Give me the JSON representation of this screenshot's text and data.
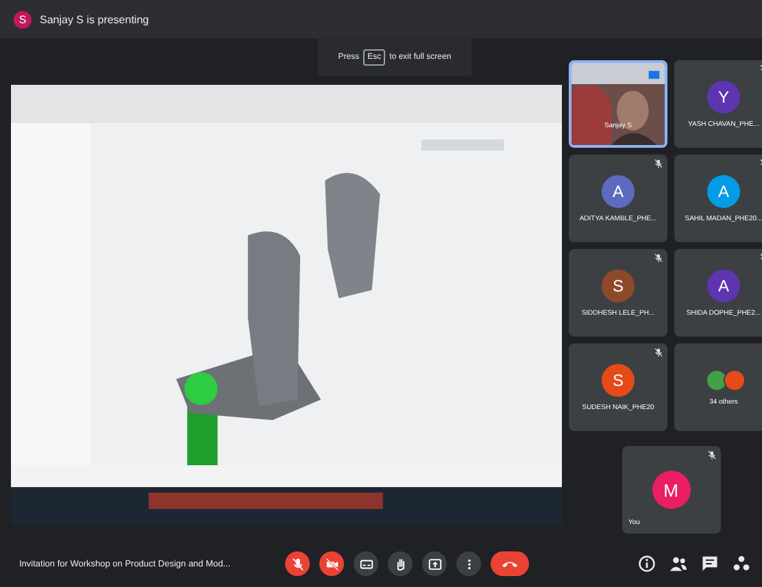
{
  "top_bar": {
    "presenter_avatar": {
      "initial": "S",
      "color": "#c2185b"
    },
    "text": "Sanjay S is presenting"
  },
  "toast": {
    "before": "Press",
    "key": "Esc",
    "after": "to exit full screen"
  },
  "video_tile": {
    "name": "Sanjay S"
  },
  "tiles": [
    {
      "kind": "avatar",
      "initial": "Y",
      "color": "#5e35b1",
      "name": "YASH CHAVAN_PHE...",
      "muted": true
    },
    {
      "kind": "avatar",
      "initial": "A",
      "color": "#5c6bc0",
      "name": "ADITYA KAMBLE_PHE...",
      "muted": true
    },
    {
      "kind": "avatar",
      "initial": "A",
      "color": "#039be5",
      "name": "SAHIL MADAN_PHE20...",
      "muted": true
    },
    {
      "kind": "avatar",
      "initial": "S",
      "color": "#8d4a2a",
      "name": "SIDDHESH LELE_PH...",
      "muted": true
    },
    {
      "kind": "avatar",
      "initial": "A",
      "color": "#5e35b1",
      "name": "SHIDA DOPHE_PHE2...",
      "muted": true
    },
    {
      "kind": "avatar",
      "initial": "S",
      "color": "#e64a19",
      "name": "SUDESH NAIK_PHE20",
      "muted": true
    },
    {
      "kind": "others",
      "avatars": [
        {
          "color": "#43a047"
        },
        {
          "color": "#e64a19"
        }
      ],
      "name": "34 others",
      "muted": false
    }
  ],
  "self_tile": {
    "initial": "M",
    "color": "#e91e63",
    "name": "You",
    "muted": true
  },
  "meeting_title": "Invitation for Workshop on Product Design and Mod...",
  "controls": [
    {
      "kind": "mic",
      "on": false
    },
    {
      "kind": "camera",
      "on": false
    },
    {
      "kind": "captions",
      "on": false
    },
    {
      "kind": "hand",
      "on": false
    },
    {
      "kind": "present",
      "on": false
    },
    {
      "kind": "more",
      "on": false
    },
    {
      "kind": "hangup"
    }
  ],
  "side_buttons": [
    {
      "kind": "info"
    },
    {
      "kind": "people"
    },
    {
      "kind": "chat"
    },
    {
      "kind": "activities"
    }
  ]
}
